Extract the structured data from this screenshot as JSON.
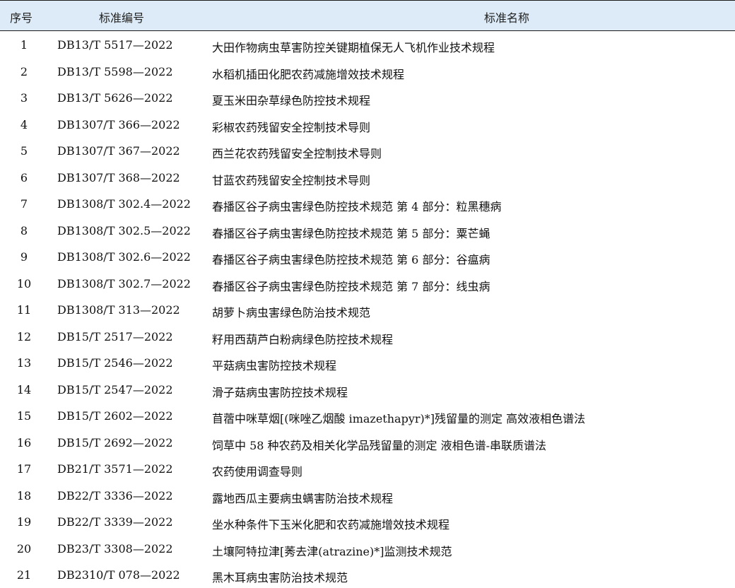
{
  "header": {
    "no": "序号",
    "code": "标准编号",
    "name": "标准名称"
  },
  "rows": [
    {
      "no": "1",
      "code": "DB13/T 5517—2022",
      "name": "大田作物病虫草害防控关键期植保无人飞机作业技术规程"
    },
    {
      "no": "2",
      "code": "DB13/T 5598—2022",
      "name": "水稻机插田化肥农药减施增效技术规程"
    },
    {
      "no": "3",
      "code": "DB13/T 5626—2022",
      "name": "夏玉米田杂草绿色防控技术规程"
    },
    {
      "no": "4",
      "code": "DB1307/T 366—2022",
      "name": "彩椒农药残留安全控制技术导则"
    },
    {
      "no": "5",
      "code": "DB1307/T 367—2022",
      "name": "西兰花农药残留安全控制技术导则"
    },
    {
      "no": "6",
      "code": "DB1307/T 368—2022",
      "name": "甘蓝农药残留安全控制技术导则"
    },
    {
      "no": "7",
      "code": "DB1308/T 302.4—2022",
      "name": "春播区谷子病虫害绿色防控技术规范  第 4 部分：粒黑穗病"
    },
    {
      "no": "8",
      "code": "DB1308/T 302.5—2022",
      "name": "春播区谷子病虫害绿色防控技术规范  第 5 部分：粟芒蝇"
    },
    {
      "no": "9",
      "code": "DB1308/T 302.6—2022",
      "name": "春播区谷子病虫害绿色防控技术规范  第 6 部分：谷瘟病"
    },
    {
      "no": "10",
      "code": "DB1308/T 302.7—2022",
      "name": "春播区谷子病虫害绿色防控技术规范  第 7 部分：线虫病"
    },
    {
      "no": "11",
      "code": "DB1308/T 313—2022",
      "name": "胡萝卜病虫害绿色防治技术规范"
    },
    {
      "no": "12",
      "code": "DB15/T 2517—2022",
      "name": "籽用西葫芦白粉病绿色防控技术规程"
    },
    {
      "no": "13",
      "code": "DB15/T 2546—2022",
      "name": "平菇病虫害防控技术规程"
    },
    {
      "no": "14",
      "code": "DB15/T 2547—2022",
      "name": "滑子菇病虫害防控技术规程"
    },
    {
      "no": "15",
      "code": "DB15/T 2602—2022",
      "name": "苜蓿中咪草烟[(咪唑乙烟酸 imazethapyr)*]残留量的测定  高效液相色谱法"
    },
    {
      "no": "16",
      "code": "DB15/T 2692—2022",
      "name": "饲草中 58 种农药及相关化学品残留量的测定  液相色谱-串联质谱法"
    },
    {
      "no": "17",
      "code": "DB21/T 3571—2022",
      "name": "农药使用调查导则"
    },
    {
      "no": "18",
      "code": "DB22/T 3336—2022",
      "name": "露地西瓜主要病虫螨害防治技术规程"
    },
    {
      "no": "19",
      "code": "DB22/T 3339—2022",
      "name": "坐水种条件下玉米化肥和农药减施增效技术规程"
    },
    {
      "no": "20",
      "code": "DB23/T 3308—2022",
      "name": "土壤阿特拉津[莠去津(atrazine)*]监测技术规范"
    },
    {
      "no": "21",
      "code": "DB2310/T 078—2022",
      "name": "黑木耳病虫害防治技术规范"
    }
  ]
}
